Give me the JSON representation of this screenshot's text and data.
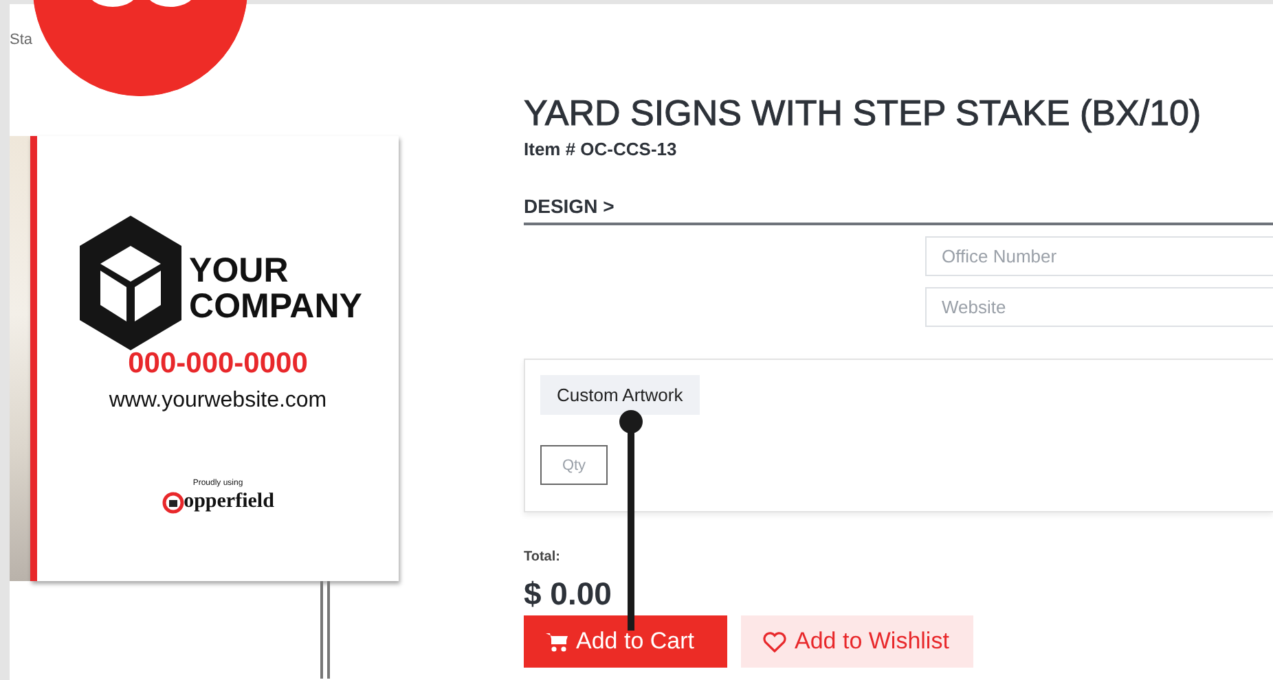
{
  "breadcrumb": "Sta",
  "sign_preview": {
    "logo_line_1": "YOUR",
    "logo_line_2": "COMPANY",
    "phone": "000-000-0000",
    "website": "www.yourwebsite.com",
    "credit": "Proudly using",
    "brand": "opperfield"
  },
  "product": {
    "title": "YARD SIGNS WITH STEP STAKE (BX/10)",
    "item_number": "Item # OC-CCS-13"
  },
  "design_step": {
    "label": "DESIGN >"
  },
  "fields": [
    {
      "placeholder": "Office Number"
    },
    {
      "placeholder": "Website"
    }
  ],
  "options_card": {
    "chip": "Custom Artwork",
    "qty_placeholder": "Qty"
  },
  "total": {
    "label": "Total:",
    "amount": "$ 0.00"
  },
  "buttons": [
    {
      "kind": "cart",
      "label": "Add to Cart"
    },
    {
      "kind": "wishlist",
      "label": "Add to Wishlist"
    }
  ]
}
